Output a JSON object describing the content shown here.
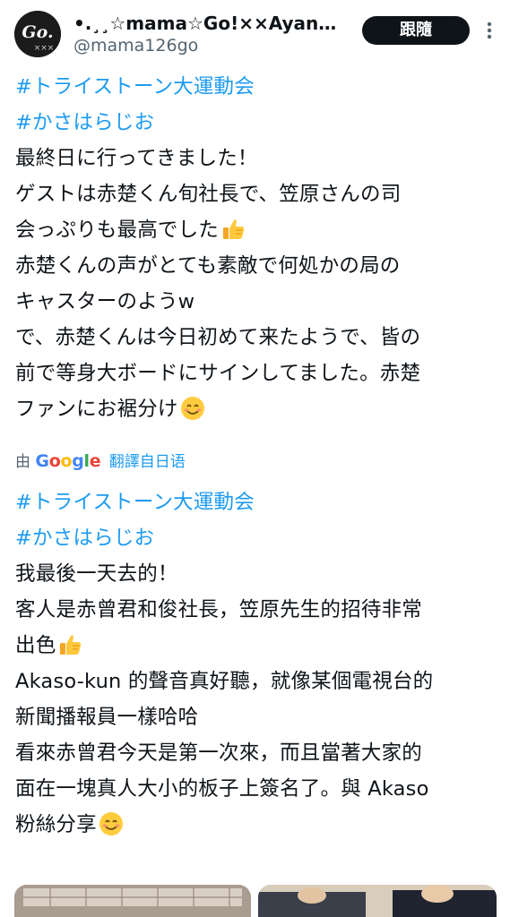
{
  "author": {
    "display_name": "•.¸¸☆mama☆Go!××Ayano…",
    "handle": "@mama126go",
    "avatar_text": "Go."
  },
  "header": {
    "follow_label": "跟隨",
    "more_icon": "more-vertical-icon"
  },
  "tweet": {
    "hashtags": [
      "#トライストーン大運動会",
      "#かさはらじお"
    ],
    "lines": [
      "最終日に行ってきました！",
      "ゲストは赤楚くん旬社長で、笠原さんの司",
      "会っぷりも最高でした",
      "赤楚くんの声がとても素敵で何処かの局の",
      "キャスターのようw",
      "で、赤楚くんは今日初めて来たようで、皆の",
      "前で等身大ボードにサインしてました。赤楚",
      "ファンにお裾分け"
    ],
    "emojis": [
      "thumbs-up-emoji",
      "smiling-face-emoji"
    ]
  },
  "translation": {
    "prefix": "由",
    "provider": "Google",
    "link_label": "翻譯自日语",
    "hashtags": [
      "#トライストーン大運動会",
      "#かさはらじお"
    ],
    "lines": [
      "我最後一天去的！",
      "客人是赤曾君和俊社長，笠原先生的招待非常",
      "出色",
      "Akaso-kun 的聲音真好聽，就像某個電視台的",
      "新聞播報員一樣哈哈",
      "看來赤曾君今天是第一次來，而且當著大家的",
      "面在一塊真人大小的板子上簽名了。與 Akaso",
      "粉絲分享"
    ]
  },
  "colors": {
    "hashtag": "#1d9bf0",
    "text": "#0f1419",
    "secondary": "#536471",
    "button_bg": "#0f1419"
  }
}
